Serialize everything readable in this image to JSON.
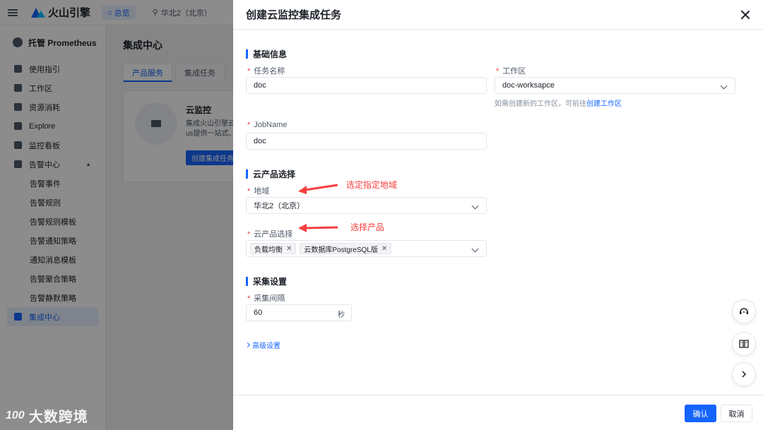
{
  "topbar": {
    "brand": "火山引擎",
    "overview": "总览",
    "region": "华北2（北京）"
  },
  "sidebar": {
    "title": "托管 Prometheus",
    "items": [
      {
        "label": "使用指引",
        "icon": "guide-icon"
      },
      {
        "label": "工作区",
        "icon": "home-icon"
      },
      {
        "label": "资源消耗",
        "icon": "resource-icon"
      },
      {
        "label": "Explore",
        "icon": "explore-icon"
      },
      {
        "label": "监控看板",
        "icon": "dashboard-icon"
      },
      {
        "label": "告警中心",
        "icon": "shield-icon"
      }
    ],
    "sub_items": [
      "告警事件",
      "告警规则",
      "告警规则模板",
      "告警通知策略",
      "通知消息模板",
      "告警聚合策略",
      "告警静默策略"
    ],
    "active_item": "集成中心"
  },
  "main": {
    "title": "集成中心",
    "tabs": [
      "产品服务",
      "集成任务"
    ],
    "card": {
      "name": "云监控",
      "desc_line1": "集成火山引擎云监",
      "desc_line2": "us提供一站式、全",
      "button": "创建集成任务"
    }
  },
  "watermark": {
    "logo": "100",
    "text": "大数跨境"
  },
  "drawer": {
    "title": "创建云监控集成任务",
    "basic": {
      "section": "基础信息",
      "task_name_label": "任务名称",
      "task_name_value": "doc",
      "workspace_label": "工作区",
      "workspace_value": "doc-worksapce",
      "help_text": "如需创建新的工作区，可前往",
      "help_link": "创建工作区",
      "jobname_label": "JobName",
      "jobname_value": "doc"
    },
    "cloud": {
      "section": "云产品选择",
      "region_label": "地域",
      "region_value": "华北2（北京）",
      "product_label": "云产品选择",
      "products": [
        "负载均衡",
        "云数据库PostgreSQL版"
      ]
    },
    "collect": {
      "section": "采集设置",
      "interval_label": "采集间隔",
      "interval_value": "60",
      "interval_unit": "秒"
    },
    "advanced": "高级设置",
    "confirm": "确认",
    "cancel": "取消",
    "annotations": {
      "region_note": "选定指定地域",
      "product_note": "选择产品"
    }
  },
  "colors": {
    "primary": "#1664ff",
    "required": "#f53f3f",
    "annotation": "#f53f3f"
  }
}
